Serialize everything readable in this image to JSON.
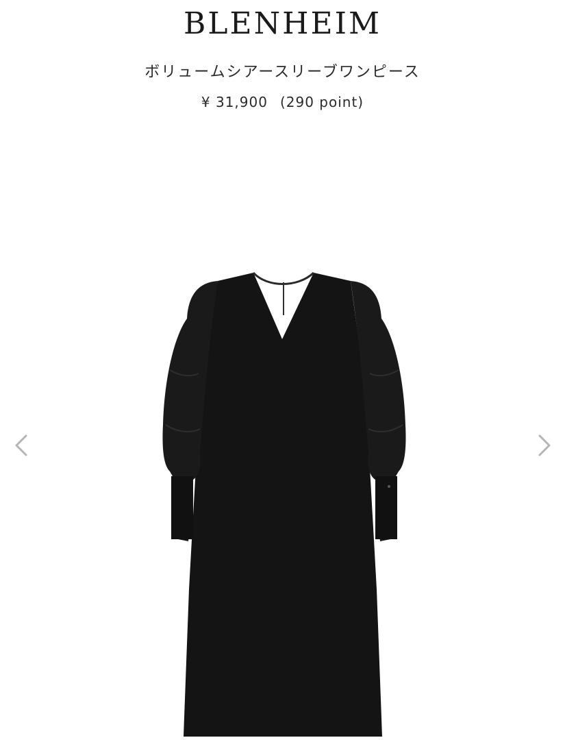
{
  "header": {
    "brand": "BLENHEIM"
  },
  "product": {
    "name": "ボリュームシアースリーブワンピース",
    "price": "¥ 31,900",
    "points": "(290 point)"
  },
  "gallery": {
    "prev_icon": "chevron-left-icon",
    "next_icon": "chevron-right-icon",
    "image": "black-v-neck-dress-photo",
    "colors": {
      "dress": "#141414",
      "arrow": "#b5b5b5"
    }
  }
}
